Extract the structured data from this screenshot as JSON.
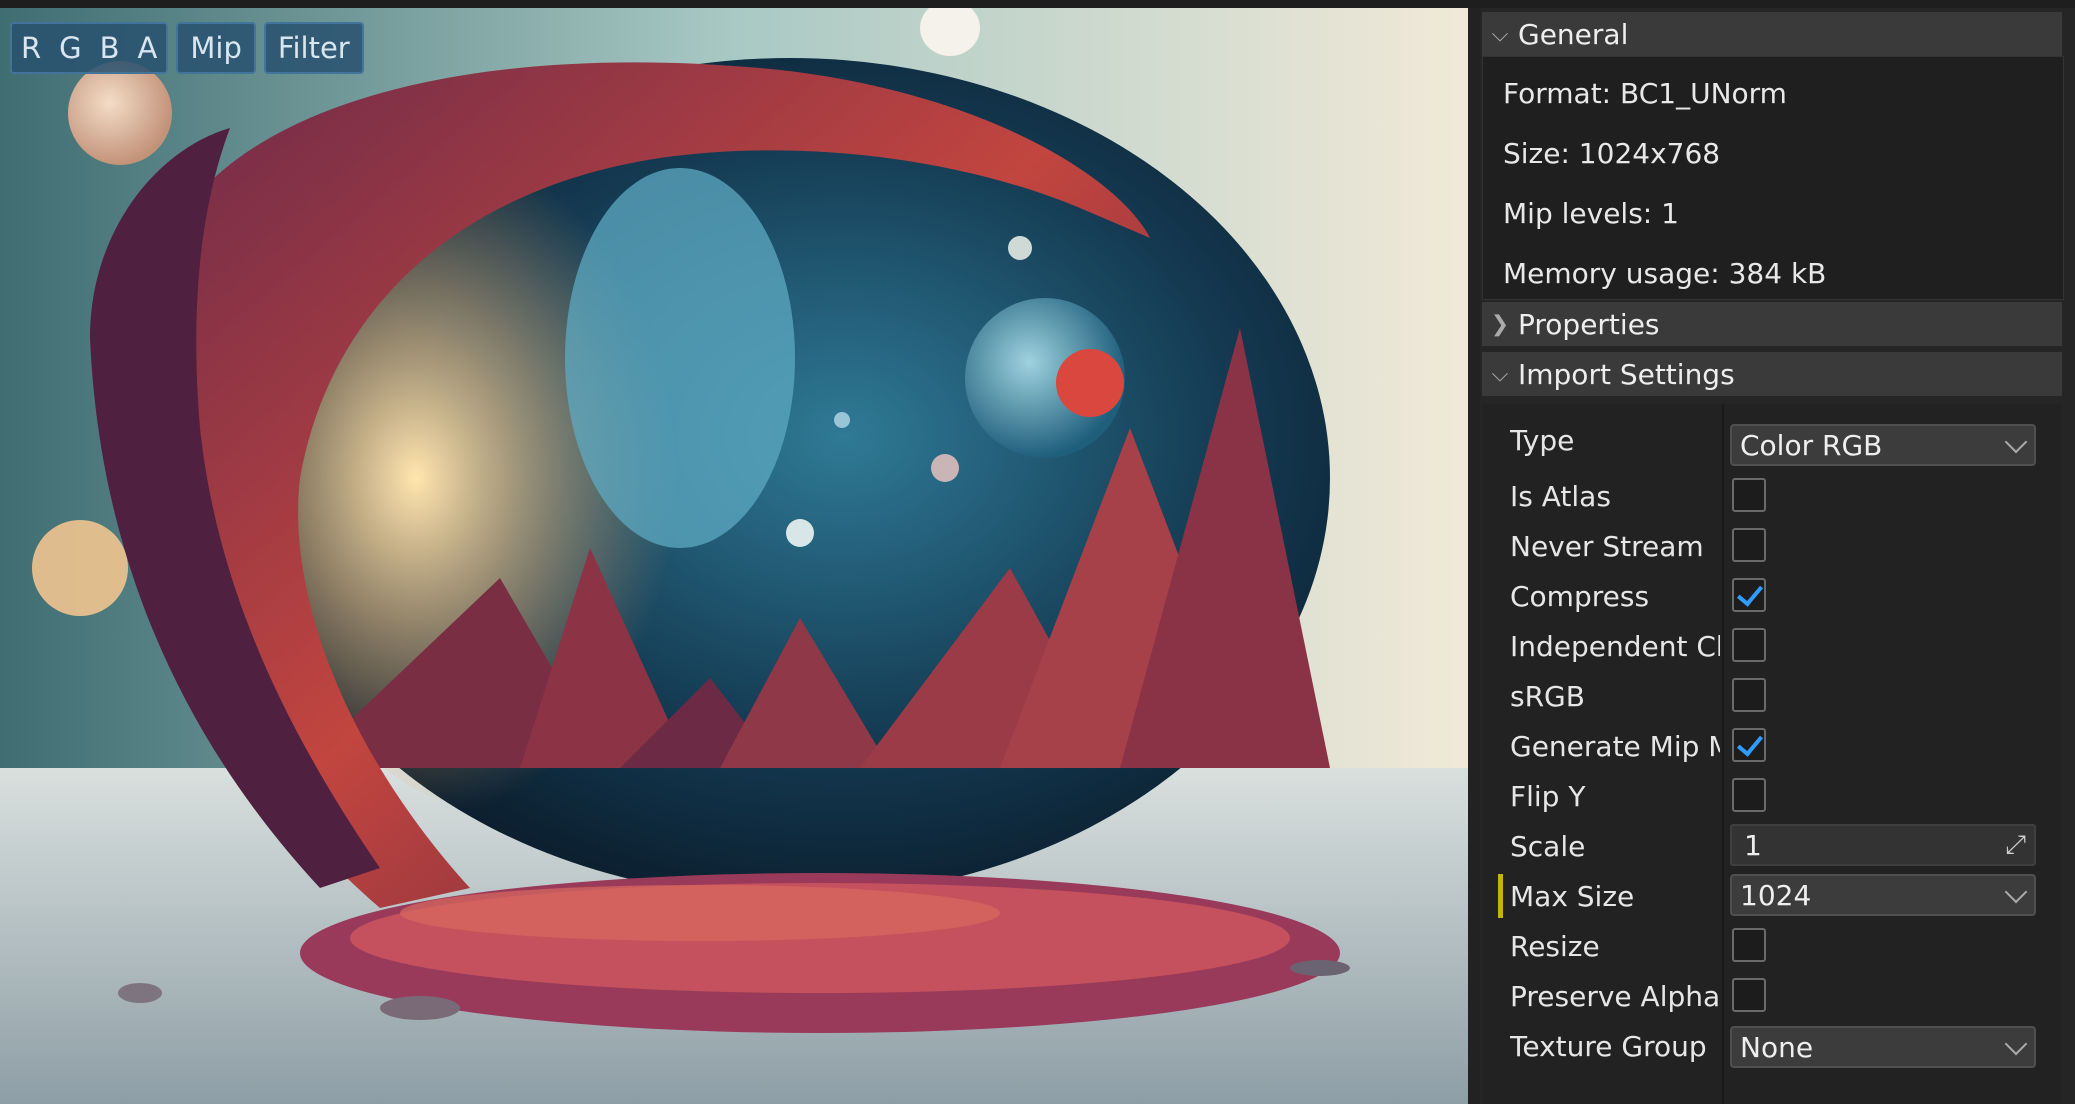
{
  "toolbar": {
    "channels": [
      "R",
      "G",
      "B",
      "A"
    ],
    "mip_label": "Mip",
    "filter_label": "Filter"
  },
  "general": {
    "title": "General",
    "format": "Format: BC1_UNorm",
    "size": "Size: 1024x768",
    "mip_levels": "Mip levels: 1",
    "memory": "Memory usage: 384 kB"
  },
  "properties": {
    "title": "Properties"
  },
  "import_settings": {
    "title": "Import Settings",
    "type": {
      "label": "Type",
      "value": "Color RGB"
    },
    "is_atlas": {
      "label": "Is Atlas",
      "checked": false
    },
    "never_stream": {
      "label": "Never Stream",
      "checked": false
    },
    "compress": {
      "label": "Compress",
      "checked": true
    },
    "independent_channels": {
      "label": "Independent Ch",
      "checked": false
    },
    "srgb": {
      "label": "sRGB",
      "checked": false
    },
    "generate_mip_maps": {
      "label": "Generate Mip M",
      "checked": true
    },
    "flip_y": {
      "label": "Flip Y",
      "checked": false
    },
    "scale": {
      "label": "Scale",
      "value": "1"
    },
    "max_size": {
      "label": "Max Size",
      "value": "1024"
    },
    "resize": {
      "label": "Resize",
      "checked": false
    },
    "preserve_alpha": {
      "label": "Preserve Alpha",
      "checked": false
    },
    "texture_group": {
      "label": "Texture Group",
      "value": "None"
    }
  },
  "colors": {
    "accent_check": "#2f9bff",
    "modified_marker": "#c8b400"
  }
}
